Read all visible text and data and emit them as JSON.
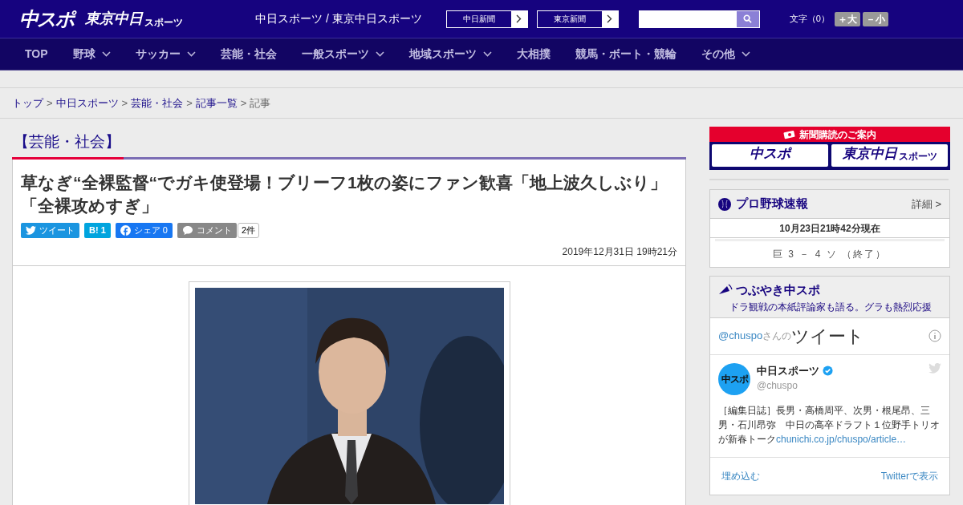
{
  "header": {
    "logo_main": "中スポ",
    "logo_sub_main": "東京中日",
    "logo_sub_small": "スポーツ",
    "tagline": "中日スポーツ / 東京中日スポーツ",
    "paper_links": [
      "中日新聞",
      "東京新聞"
    ],
    "font_size_label": "文字（0）",
    "font_buttons": [
      "＋大",
      "－小"
    ]
  },
  "nav": [
    {
      "label": "TOP",
      "dropdown": false
    },
    {
      "label": "野球",
      "dropdown": true
    },
    {
      "label": "サッカー",
      "dropdown": true
    },
    {
      "label": "芸能・社会",
      "dropdown": false
    },
    {
      "label": "一般スポーツ",
      "dropdown": true
    },
    {
      "label": "地域スポーツ",
      "dropdown": true
    },
    {
      "label": "大相撲",
      "dropdown": false
    },
    {
      "label": "競馬・ボート・競輪",
      "dropdown": false
    },
    {
      "label": "その他",
      "dropdown": true
    }
  ],
  "breadcrumb": [
    {
      "label": "トップ",
      "link": true
    },
    {
      "separator": ">",
      "label": "中日スポーツ",
      "link": true
    },
    {
      "separator": ">",
      "label": "芸能・社会",
      "link": true
    },
    {
      "separator": ">",
      "label": "記事一覧",
      "link": true
    },
    {
      "separator": ">",
      "label": "記事",
      "link": false
    }
  ],
  "category": "【芸能・社会】",
  "article": {
    "title": "草なぎ“全裸監督“でガキ使登場！ブリーフ1枚の姿にファン歓喜「地上波久しぶり」「全裸攻めすぎ」",
    "share": [
      {
        "kind": "twitter",
        "label": "ツイート"
      },
      {
        "kind": "hatena",
        "label": "B! 1"
      },
      {
        "kind": "facebook",
        "label": "シェア 0"
      },
      {
        "kind": "comment",
        "label": "コメント"
      }
    ],
    "comment_count": "2件",
    "date": "2019年12月31日 19時21分"
  },
  "sidebar": {
    "subscribe": {
      "title": "新聞購読のご案内",
      "logos": [
        "中スポ",
        "東京中日"
      ],
      "logo_small": "スポーツ"
    },
    "baseball": {
      "title": "プロ野球速報",
      "more": "詳細 >",
      "time": "10月23日21時42分現在",
      "score": "巨 3 － 4 ソ （終了）"
    },
    "tweets": {
      "title": "つぶやき中スポ",
      "subtitle": "ドラ観戦の本紙評論家も語る。グラも熱烈応援",
      "handle": "@chuspo",
      "handle_suffix": "さんの",
      "heading": "ツイート",
      "tweet": {
        "name": "中日スポーツ",
        "verified": true,
        "user": "@chuspo",
        "avatar": "中スポ",
        "text": "［編集日誌］長男・高橋周平、次男・根尾昂、三男・石川昂弥　中日の高卒ドラフト１位野手トリオが新春トーク",
        "link": "chunichi.co.jp/chuspo/article…"
      },
      "embed": "埋め込む",
      "view": "Twitterで表示"
    }
  }
}
